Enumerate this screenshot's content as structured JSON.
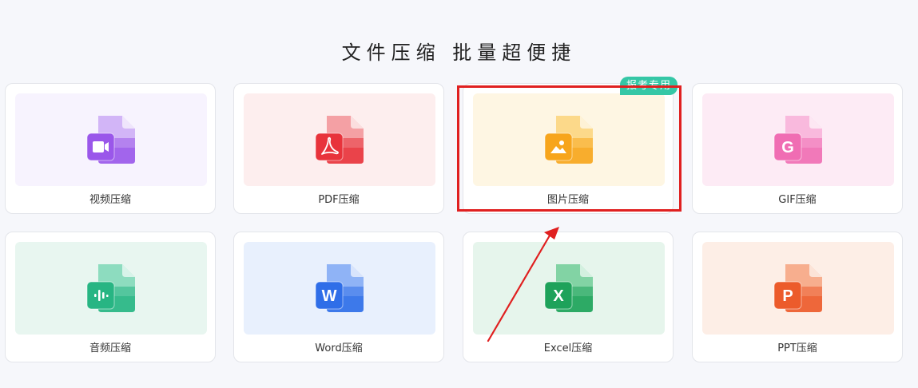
{
  "heading": "文件压缩  批量超便捷",
  "cards": [
    {
      "label": "视频压缩",
      "icon": "video-file-icon",
      "panel_color": "#f7f3fe",
      "dark": "#9a57ea",
      "light": "#d2b5f7",
      "glyph": "camera"
    },
    {
      "label": "PDF压缩",
      "icon": "pdf-file-icon",
      "panel_color": "#fdeeee",
      "dark": "#e8333b",
      "light": "#f4a0a4",
      "glyph": "pdf"
    },
    {
      "label": "图片压缩",
      "icon": "image-file-icon",
      "panel_color": "#fef6e3",
      "dark": "#f7a51c",
      "light": "#fcd98a",
      "glyph": "image",
      "badge": "报考专用",
      "badge_color": "#35c7a6"
    },
    {
      "label": "GIF压缩",
      "icon": "gif-file-icon",
      "panel_color": "#fdebf5",
      "dark": "#f06db3",
      "light": "#f9b9dd",
      "glyph": "G"
    },
    {
      "label": "音频压缩",
      "icon": "audio-file-icon",
      "panel_color": "#e8f6f0",
      "dark": "#27b583",
      "light": "#8ddcbf",
      "glyph": "audio"
    },
    {
      "label": "Word压缩",
      "icon": "word-file-icon",
      "panel_color": "#e8f0fd",
      "dark": "#2f6ee8",
      "light": "#8fb3f6",
      "glyph": "W"
    },
    {
      "label": "Excel压缩",
      "icon": "excel-file-icon",
      "panel_color": "#e6f5ec",
      "dark": "#1ea25a",
      "light": "#82d3a4",
      "glyph": "X"
    },
    {
      "label": "PPT压缩",
      "icon": "ppt-file-icon",
      "panel_color": "#fdeee6",
      "dark": "#ec5b2b",
      "light": "#f7ae8e",
      "glyph": "P"
    }
  ],
  "annotation": {
    "highlight_color": "#e02020"
  }
}
